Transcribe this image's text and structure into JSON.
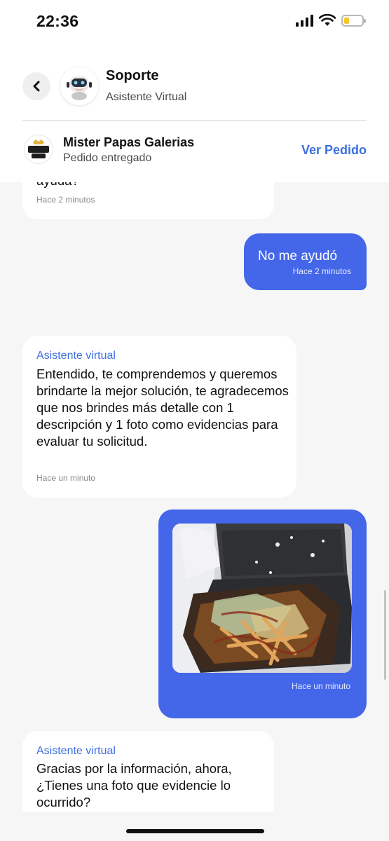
{
  "status_bar": {
    "time": "22:36",
    "battery_level": 0.3
  },
  "header": {
    "back_icon": "chevron-left-icon",
    "contact_name": "Soporte",
    "contact_subtitle": "Asistente Virtual",
    "store_name": "Mister Papas Galerias",
    "order_status": "Pedido entregado",
    "view_order_label": "Ver Pedido",
    "store_logo_text": "MISTER PAPAS"
  },
  "messages": [
    {
      "direction": "in",
      "text": "ayuda?",
      "time": "Hace 2 minutos"
    },
    {
      "direction": "out",
      "text": "No me ayudó",
      "time": "Hace 2 minutos"
    },
    {
      "direction": "in",
      "sender": "Asistente virtual",
      "text": "Entendido, te comprendemos y queremos brindarte la mejor solución, te agradecemos que nos brindes más detalle con 1 descripción y 1 foto como evidencias para evaluar tu solicitud.",
      "time": "Hace un minuto"
    },
    {
      "direction": "out",
      "type": "image",
      "image_description": "food-photo",
      "time": "Hace un minuto"
    },
    {
      "direction": "in",
      "sender": "Asistente virtual",
      "text": "Gracias por la información, ahora, ¿Tienes una foto que evidencie lo ocurrido?"
    }
  ],
  "colors": {
    "accent": "#3d6fe0",
    "outgoing_bubble": "#4467ea",
    "background": "#f6f6f6"
  }
}
